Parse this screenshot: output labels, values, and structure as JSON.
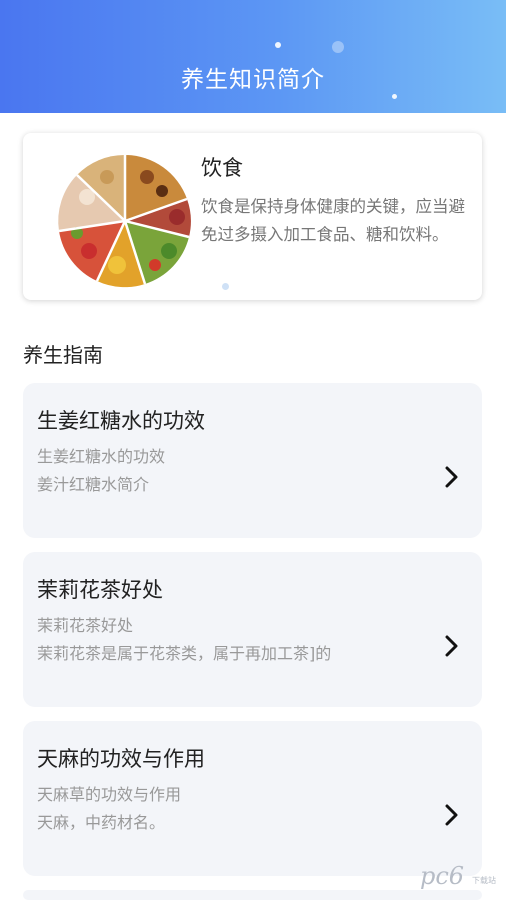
{
  "header": {
    "title": "养生知识简介"
  },
  "banner": {
    "title": "饮食",
    "description": "饮食是保持身体健康的关键，应当避免过多摄入加工食品、糖和饮料。",
    "image": "food-pyramid-plate"
  },
  "section": {
    "title": "养生指南"
  },
  "cards": [
    {
      "title": "生姜红糖水的功效",
      "subtitle": "生姜红糖水的功效",
      "desc": "姜汁红糖水简介"
    },
    {
      "title": "茉莉花茶好处",
      "subtitle": "茉莉花茶好处",
      "desc": "茉莉花茶是属于花茶类，属于再加工茶]的"
    },
    {
      "title": "天麻的功效与作用",
      "subtitle": "天麻草的功效与作用",
      "desc": "天麻，中药材名。"
    }
  ],
  "watermark": {
    "text": "pc6",
    "sub": "下载站"
  },
  "icons": {
    "card_arrow": "chevron-right-icon"
  },
  "colors": {
    "header_start": "#4a76f0",
    "header_end": "#79bdf6",
    "card_bg": "#f3f5f9"
  }
}
